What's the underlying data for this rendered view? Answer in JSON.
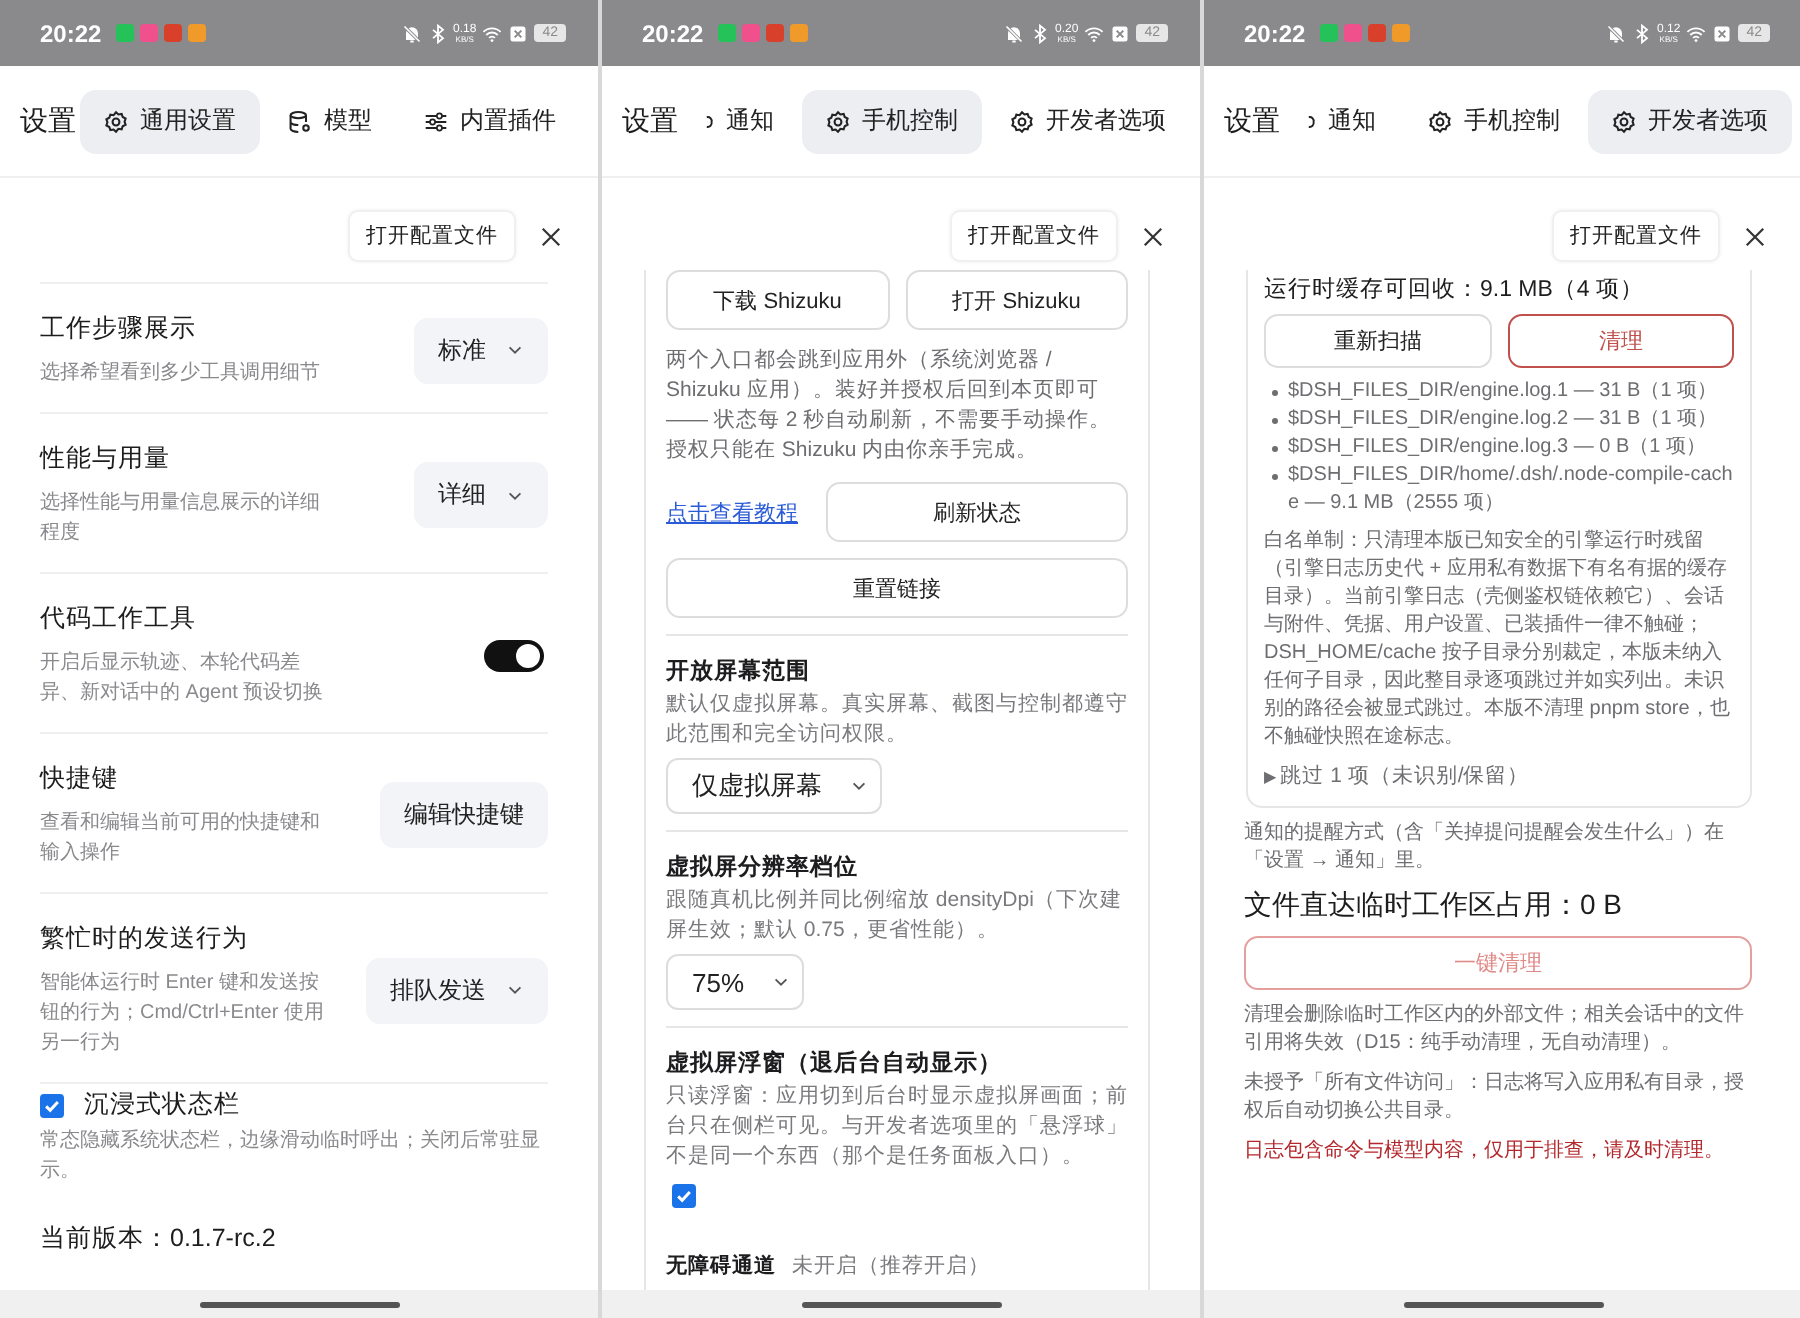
{
  "screens": [
    {
      "status_bar": {
        "time": "20:22",
        "speed": "0.18",
        "speed_unit": "KB/S",
        "battery": "42"
      },
      "title": "设置",
      "tabs": [
        {
          "label": "通用设置",
          "selected": true
        },
        {
          "label": "模型",
          "selected": false
        },
        {
          "label": "内置插件",
          "selected": false
        }
      ],
      "open_config_button": "打开配置文件",
      "blocks": [
        {
          "kind": "setting",
          "title": "工作步骤展示",
          "description": "选择希望看到多少工具调用细节",
          "control": {
            "kind": "select",
            "value": "标准"
          }
        },
        {
          "kind": "setting",
          "title": "性能与用量",
          "description": "选择性能与用量信息展示的详细程度",
          "control": {
            "kind": "select",
            "value": "详细"
          }
        },
        {
          "kind": "setting",
          "title": "代码工作工具",
          "description": "开启后显示轨迹、本轮代码差异、新对话中的 Agent 预设切换",
          "control": {
            "kind": "toggle",
            "on": true
          }
        },
        {
          "kind": "setting",
          "title": "快捷键",
          "description": "查看和编辑当前可用的快捷键和输入操作",
          "control": {
            "kind": "button",
            "label": "编辑快捷键"
          }
        },
        {
          "kind": "setting",
          "title": "繁忙时的发送行为",
          "description": "智能体运行时 Enter 键和发送按钮的行为；Cmd/Ctrl+Enter 使用另一行为",
          "control": {
            "kind": "select",
            "value": "排队发送"
          }
        },
        {
          "kind": "checkbox_setting",
          "title": "沉浸式状态栏",
          "description": "常态隐藏系统状态栏，边缘滑动临时呼出；关闭后常驻显示。",
          "checked": true
        },
        {
          "kind": "version",
          "text": "当前版本：0.1.7-rc.2"
        }
      ]
    },
    {
      "status_bar": {
        "time": "20:22",
        "speed": "0.20",
        "speed_unit": "KB/S",
        "battery": "42"
      },
      "title": "设置",
      "tabs": [
        {
          "label": "通知",
          "selected": false
        },
        {
          "label": "手机控制",
          "selected": true
        },
        {
          "label": "开发者选项",
          "selected": false
        }
      ],
      "open_config_button": "打开配置文件",
      "card": [
        {
          "kind": "button_pair",
          "buttons": [
            {
              "label": "下载 Shizuku",
              "kind": "outline"
            },
            {
              "label": "打开 Shizuku",
              "kind": "outline"
            }
          ]
        },
        {
          "kind": "paragraph",
          "text": "两个入口都会跳到应用外（系统浏览器 / Shizuku 应用）。装好并授权后回到本页即可—— 状态每 2 秒自动刷新，不需要手动操作。授权只能在 Shizuku 内由你亲手完成。"
        },
        {
          "kind": "link_row",
          "link": "点击查看教程",
          "button": "刷新状态"
        },
        {
          "kind": "wide_button",
          "label": "重置链接"
        },
        {
          "kind": "section",
          "title": "开放屏幕范围",
          "description": "默认仅虚拟屏幕。真实屏幕、截图与控制都遵守此范围和完全访问权限。",
          "control": {
            "kind": "select",
            "value": "仅虚拟屏幕"
          }
        },
        {
          "kind": "section",
          "title": "虚拟屏分辨率档位",
          "description": "跟随真机比例并同比例缩放 densityDpi（下次建屏生效；默认 0.75，更省性能）。",
          "control": {
            "kind": "select",
            "value": "75%"
          }
        },
        {
          "kind": "section",
          "title": "虚拟屏浮窗（退后台自动显示）",
          "description": "只读浮窗：应用切到后台时显示虚拟屏画面；前台只在侧栏可见。与开发者选项里的「悬浮球」不是同一个东西（那个是任务面板入口）。",
          "control": {
            "kind": "checkbox",
            "checked": true
          }
        },
        {
          "kind": "status_line",
          "label": "无障碍通道",
          "value": "未开启（推荐开启）"
        }
      ]
    },
    {
      "status_bar": {
        "time": "20:22",
        "speed": "0.12",
        "speed_unit": "KB/S",
        "battery": "42"
      },
      "title": "设置",
      "tabs": [
        {
          "label": "通知",
          "selected": false
        },
        {
          "label": "手机控制",
          "selected": false
        },
        {
          "label": "开发者选项",
          "selected": true
        }
      ],
      "open_config_button": "打开配置文件",
      "card": [
        {
          "kind": "heading",
          "text": "运行时缓存可回收：9.1 MB（4 项）"
        },
        {
          "kind": "button_pair",
          "buttons": [
            {
              "label": "重新扫描",
              "kind": "outline"
            },
            {
              "label": "清理",
              "kind": "danger"
            }
          ]
        },
        {
          "kind": "bullets",
          "items": [
            "$DSH_FILES_DIR/engine.log.1 — 31 B（1 项）",
            "$DSH_FILES_DIR/engine.log.2 — 31 B（1 项）",
            "$DSH_FILES_DIR/engine.log.3 — 0 B（1 项）",
            "$DSH_FILES_DIR/home/.dsh/.node-compile-cache — 9.1 MB（2555 项）"
          ]
        },
        {
          "kind": "paragraph",
          "text": "白名单制：只清理本版已知安全的引擎运行时残留（引擎日志历史代 + 应用私有数据下有名有据的缓存目录）。当前引擎日志（壳侧鉴权链依赖它）、会话与附件、凭据、用户设置、已装插件一律不触碰；DSH_HOME/cache 按子目录分别裁定，本版未纳入任何子目录，因此整目录逐项跳过并如实列出。未识别的路径会被显式跳过。本版不清理 pnpm store，也不触碰快照在途标志。"
        },
        {
          "kind": "disclosure",
          "marker": "▶",
          "text": "跳过 1 项（未识别/保留）",
          "expanded": false
        }
      ],
      "blocks": [
        {
          "kind": "paragraph",
          "text": "通知的提醒方式（含「关掉提问提醒会发生什么」）在「设置 → 通知」里。"
        },
        {
          "kind": "heading",
          "text": "文件直达临时工作区占用：0 B"
        },
        {
          "kind": "danger_wide_button",
          "label": "一键清理"
        },
        {
          "kind": "paragraph",
          "text": "清理会删除临时工作区内的外部文件；相关会话中的文件引用将失效（D15：纯手动清理，无自动清理）。"
        },
        {
          "kind": "paragraph",
          "text": "未授予「所有文件访问」：日志将写入应用私有目录，授权后自动切换公共目录。"
        },
        {
          "kind": "warning",
          "text": "日志包含命令与模型内容，仅用于排查，请及时清理。"
        }
      ]
    }
  ]
}
